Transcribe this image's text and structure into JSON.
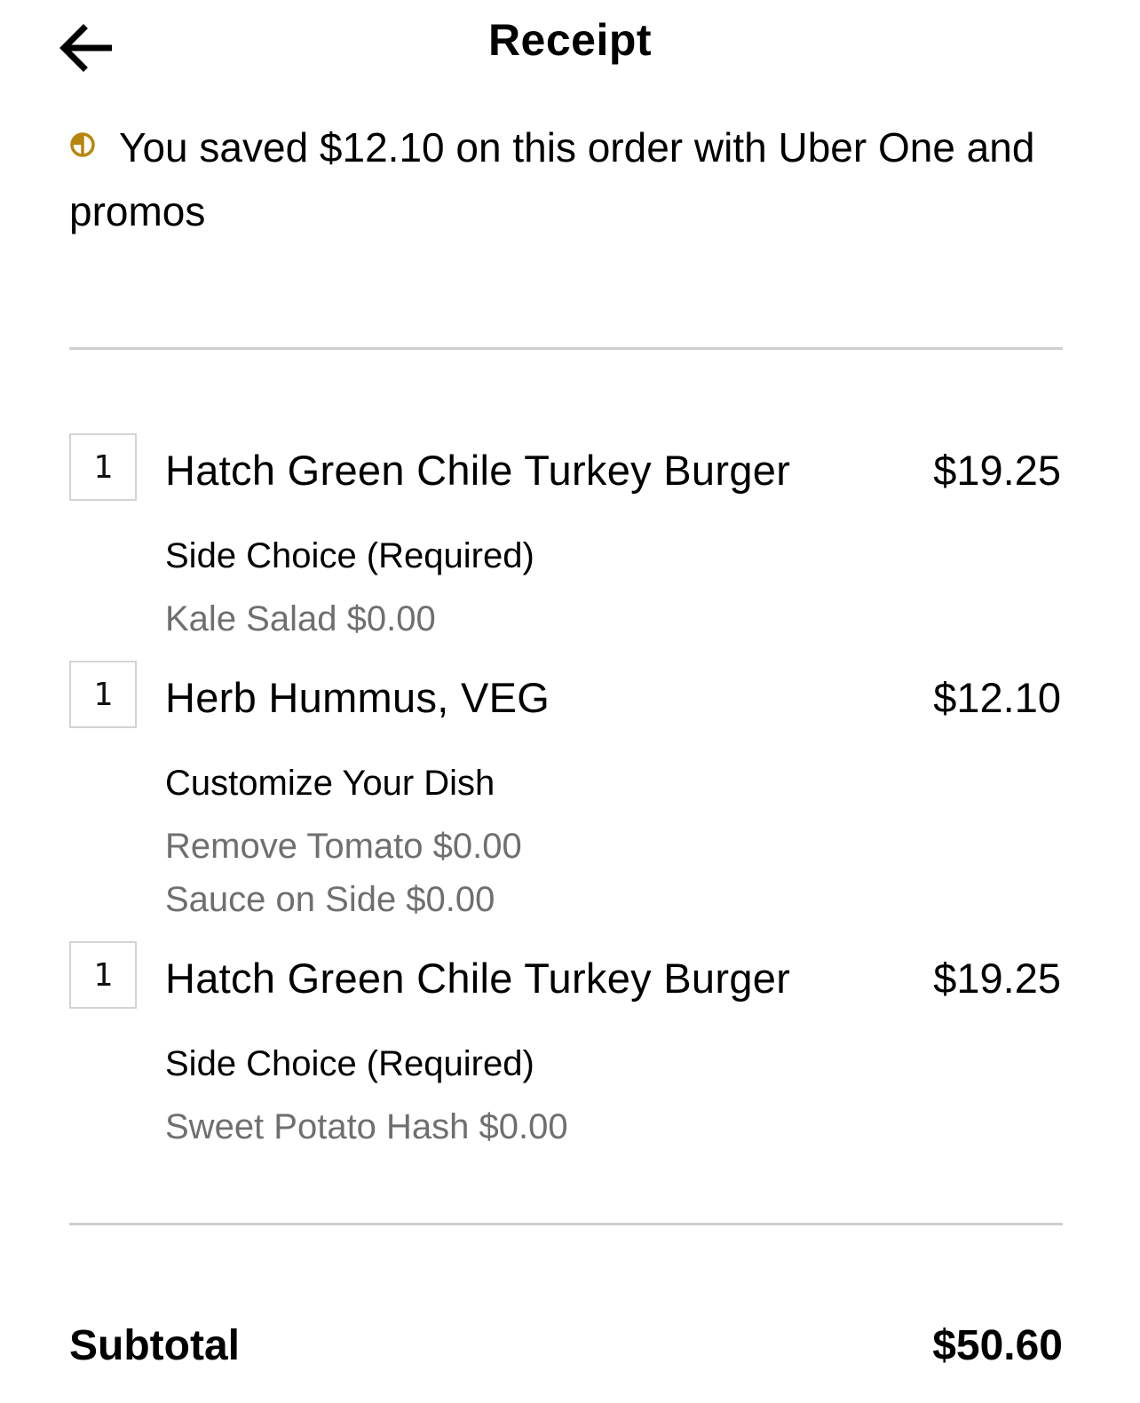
{
  "header": {
    "title": "Receipt",
    "back_icon": "arrow-left-icon"
  },
  "savings": {
    "icon": "uber-one-icon",
    "icon_color": "#b8860b",
    "text": "You saved $12.10 on this order with Uber One and promos"
  },
  "items": [
    {
      "quantity": "1",
      "name": "Hatch Green Chile Turkey Burger",
      "price": "$19.25",
      "option_title": "Side Choice (Required)",
      "option_values": [
        "Kale Salad $0.00"
      ]
    },
    {
      "quantity": "1",
      "name": "Herb Hummus, VEG",
      "price": "$12.10",
      "option_title": "Customize Your Dish",
      "option_values": [
        "Remove Tomato $0.00",
        "Sauce on Side $0.00"
      ]
    },
    {
      "quantity": "1",
      "name": "Hatch Green Chile Turkey Burger",
      "price": "$19.25",
      "option_title": "Side Choice (Required)",
      "option_values": [
        "Sweet Potato Hash $0.00"
      ]
    }
  ],
  "summary": {
    "subtotal_label": "Subtotal",
    "subtotal_value": "$50.60"
  }
}
